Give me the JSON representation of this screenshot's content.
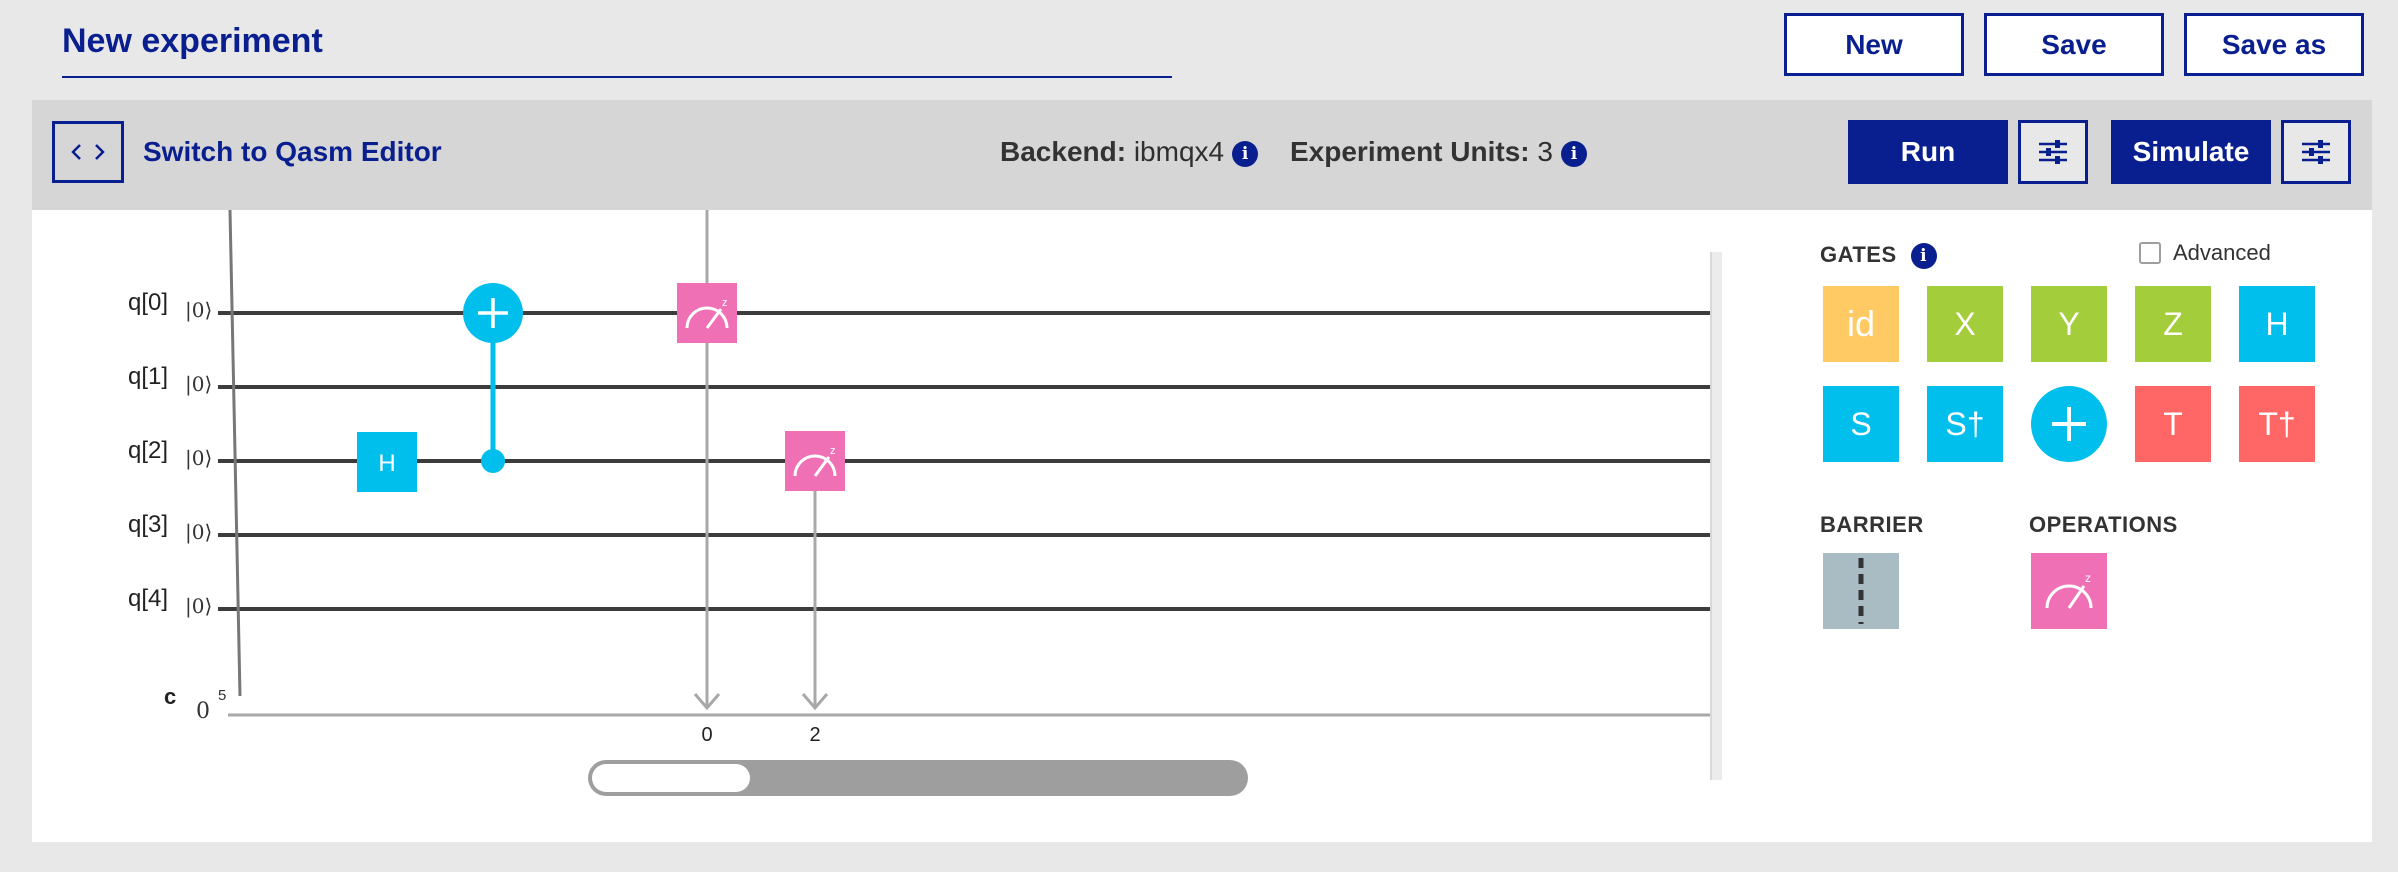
{
  "header": {
    "title": "New experiment",
    "new_label": "New",
    "save_label": "Save",
    "save_as_label": "Save as"
  },
  "toolbar": {
    "code_icon": "<‹ ›>",
    "switch_label": "Switch to Qasm Editor",
    "backend_label": "Backend:",
    "backend_value": "ibmqx4",
    "units_label": "Experiment Units:",
    "units_value": "3",
    "run_label": "Run",
    "simulate_label": "Simulate"
  },
  "circuit": {
    "qubits": [
      {
        "name": "q[0]",
        "ket": "|0⟩"
      },
      {
        "name": "q[1]",
        "ket": "|0⟩"
      },
      {
        "name": "q[2]",
        "ket": "|0⟩"
      },
      {
        "name": "q[3]",
        "ket": "|0⟩"
      },
      {
        "name": "q[4]",
        "ket": "|0⟩"
      }
    ],
    "classical": {
      "name": "c",
      "init": "0",
      "size": "5"
    },
    "h_gate_label": "H",
    "measure_targets": [
      "0",
      "2"
    ],
    "scroll_position": 0.24
  },
  "palette": {
    "gates_label": "GATES",
    "advanced_label": "Advanced",
    "gates": [
      "id",
      "X",
      "Y",
      "Z",
      "H",
      "S",
      "S†",
      "+",
      "T",
      "T†"
    ],
    "barrier_label": "BARRIER",
    "operations_label": "OPERATIONS"
  },
  "colors": {
    "primary": "#0a1f8f",
    "gate_cyan": "#00bfec",
    "gate_green": "#a4cd3c",
    "gate_yellow": "#ffca64",
    "gate_red": "#ff6666",
    "measure_pink": "#f070b6",
    "barrier_gray": "#a9bcc4"
  }
}
